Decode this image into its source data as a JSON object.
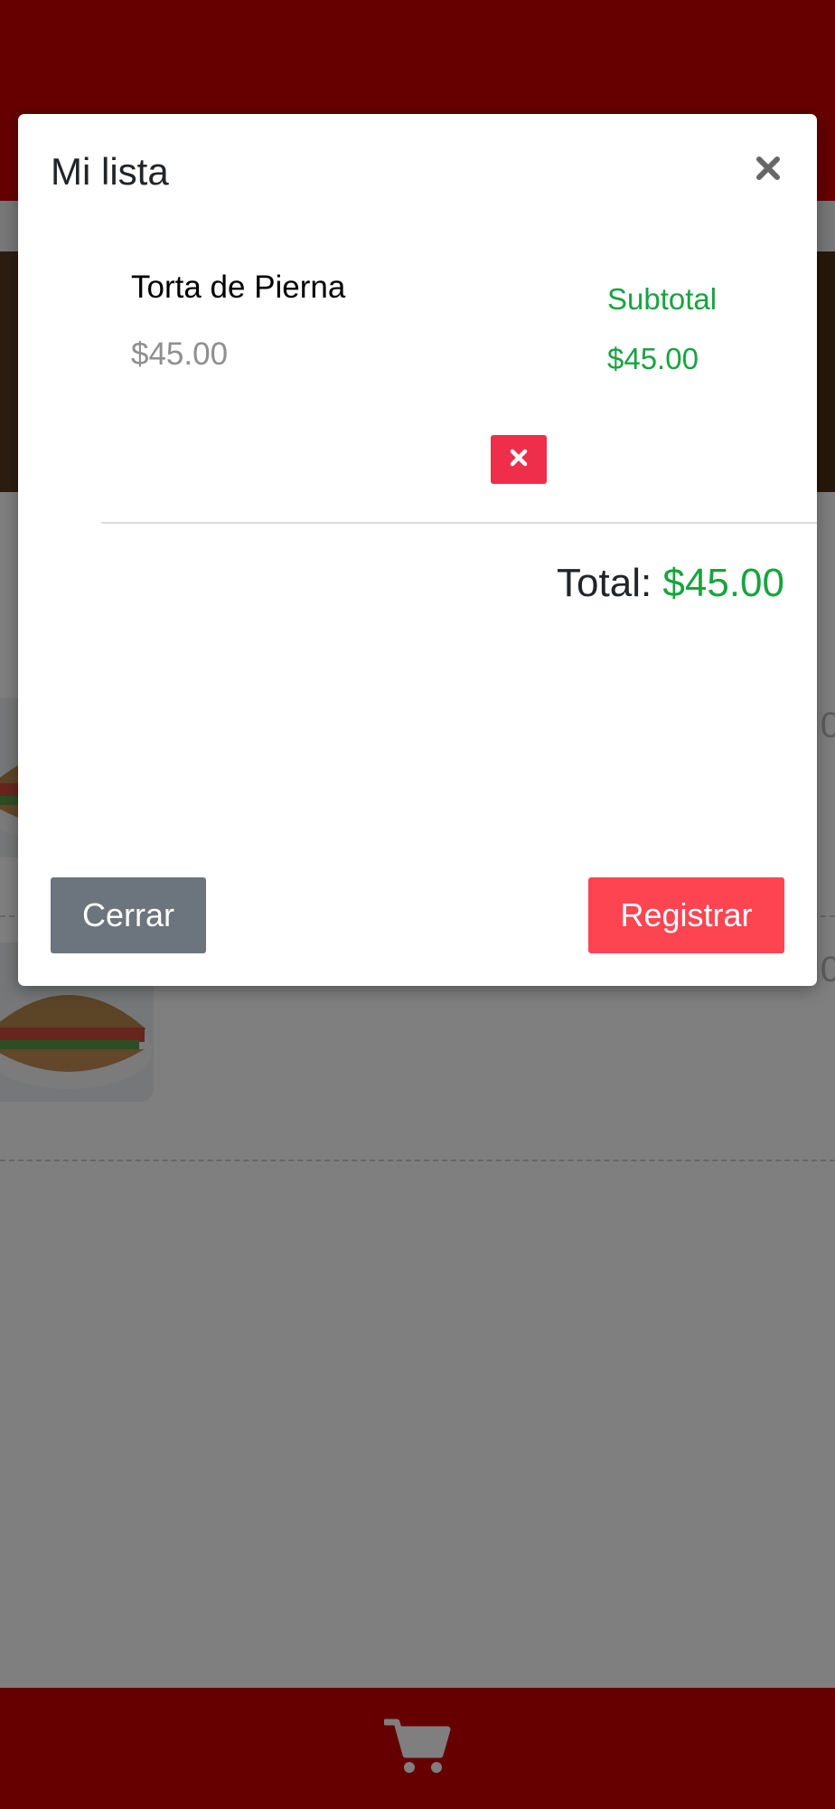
{
  "modal": {
    "title": "Mi lista",
    "close_icon": "close-icon",
    "items": [
      {
        "name": "Torta de Pierna",
        "price": "$45.00",
        "subtotal_label": "Subtotal",
        "subtotal": "$45.00"
      }
    ],
    "remove_icon": "times-icon",
    "total_label": "Total:",
    "total_value": "$45.00",
    "buttons": {
      "close": "Cerrar",
      "register": "Registrar"
    }
  },
  "footer": {
    "cart_icon": "shopping-cart-icon"
  },
  "colors": {
    "brand_red": "#cc0000",
    "success_green": "#17a43f",
    "danger": "#ee2e4a",
    "register_button": "#fd4551",
    "secondary_gray": "#6c757d"
  }
}
